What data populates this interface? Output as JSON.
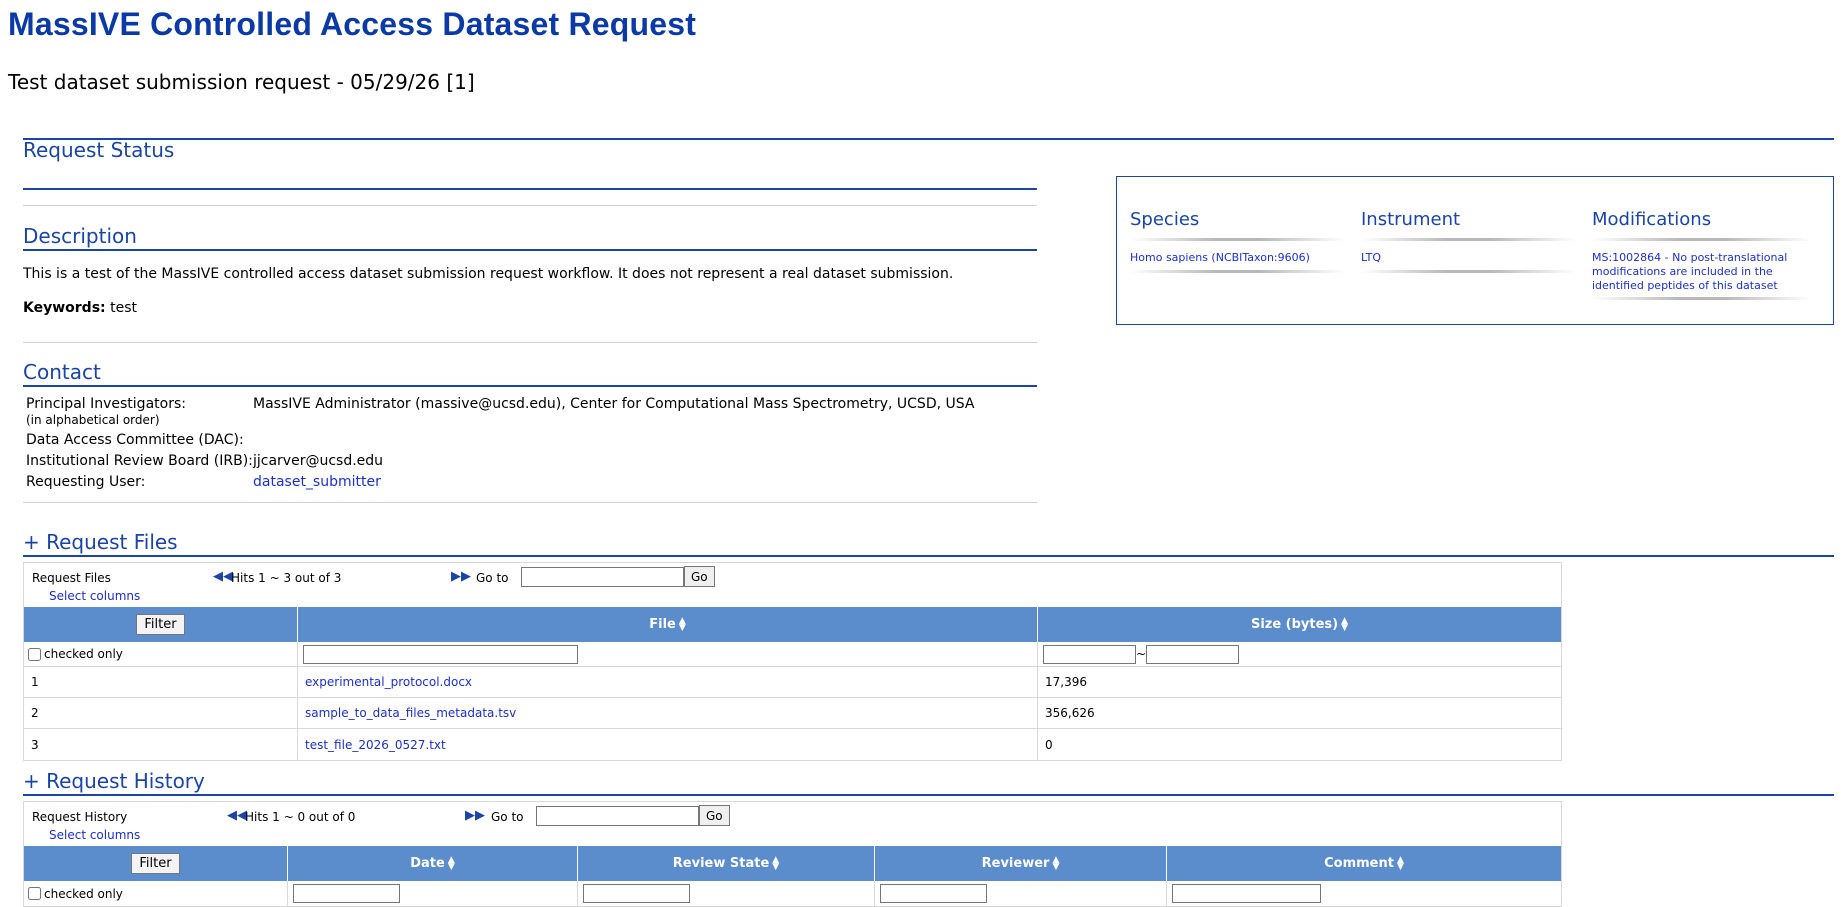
{
  "header": {
    "title": "MassIVE Controlled Access Dataset Request",
    "subtitle": "Test dataset submission request - 05/29/26 [1]"
  },
  "sections": {
    "status_title": "Request Status",
    "description_title": "Description",
    "contact_title": "Contact",
    "files_title": "+ Request Files",
    "history_title": "+ Request History"
  },
  "description": {
    "text": "This is a test of the MassIVE controlled access dataset submission request workflow. It does not represent a real dataset submission.",
    "keywords_label": "Keywords:",
    "keywords_value": "test"
  },
  "contact": {
    "pi_label": "Principal Investigators:",
    "pi_note": "(in alphabetical order)",
    "pi_value": "MassIVE Administrator (massive@ucsd.edu), Center for Computational Mass Spectrometry, UCSD, USA",
    "dac_label": "Data Access Committee (DAC):",
    "dac_value": "",
    "irb_label": "Institutional Review Board (IRB):",
    "irb_value": "jjcarver@ucsd.edu",
    "user_label": "Requesting User:",
    "user_value": "dataset_submitter"
  },
  "info_box": {
    "species_title": "Species",
    "species_value": "Homo sapiens (NCBITaxon:9606)",
    "instrument_title": "Instrument",
    "instrument_value": "LTQ",
    "modifications_title": "Modifications",
    "modifications_value": "MS:1002864 - No post-translational modifications are included in the identified peptides of this dataset"
  },
  "files_table": {
    "name": "Request Files",
    "select_columns": "Select columns",
    "hits": "Hits 1 ~ 3 out of 3",
    "goto_label": "Go to",
    "go_button": "Go",
    "filter_button": "Filter",
    "checked_only": "checked only",
    "range_sep": "~",
    "columns": [
      "File",
      "Size (bytes)"
    ],
    "rows": [
      {
        "index": "1",
        "file": "experimental_protocol.docx",
        "size": "17,396"
      },
      {
        "index": "2",
        "file": "sample_to_data_files_metadata.tsv",
        "size": "356,626"
      },
      {
        "index": "3",
        "file": "test_file_2026_0527.txt",
        "size": "0"
      }
    ]
  },
  "history_table": {
    "name": "Request History",
    "select_columns": "Select columns",
    "hits": "Hits 1 ~ 0 out of 0",
    "goto_label": "Go to",
    "go_button": "Go",
    "filter_button": "Filter",
    "checked_only": "checked only",
    "columns": [
      "Date",
      "Review State",
      "Reviewer",
      "Comment"
    ]
  },
  "colors": {
    "title_blue": "#0b3aa6",
    "section_blue": "#1a44a8",
    "link_blue": "#1a2fd1",
    "table_header": "#5b8ccb"
  }
}
